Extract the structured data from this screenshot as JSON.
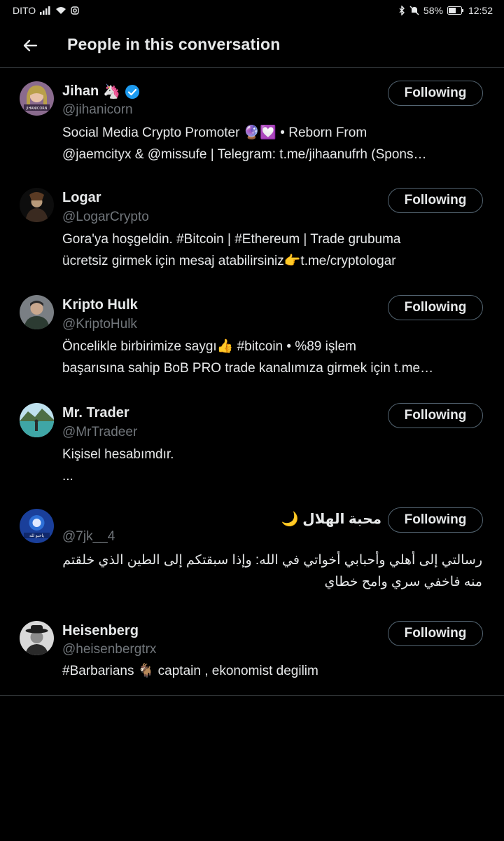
{
  "status_bar": {
    "carrier": "DITO",
    "battery": "58%",
    "time": "12:52"
  },
  "header": {
    "title": "People in this conversation"
  },
  "people": [
    {
      "name": "Jihan",
      "name_emoji": "🦄",
      "verified": true,
      "handle": "@jihanicorn",
      "bio": "Social Media Crypto Promoter 🔮💟 • Reborn From\n@jaemcityx & @missufe | Telegram: t.me/jihaanufrh (Spons…",
      "button": "Following"
    },
    {
      "name": "Logar",
      "handle": "@LogarCrypto",
      "bio": "Gora'ya hoşgeldin. #Bitcoin | #Ethereum | Trade grubuma\nücretsiz girmek için mesaj atabilirsiniz👉t.me/cryptologar",
      "button": "Following"
    },
    {
      "name": "Kripto Hulk",
      "handle": "@KriptoHulk",
      "bio": "Öncelikle birbirimize saygı👍 #bitcoin • %89 işlem\nbaşarısına sahip BoB PRO trade kanalımıza girmek için t.me…",
      "button": "Following"
    },
    {
      "name": "Mr. Trader",
      "handle": "@MrTradeer",
      "bio": "Kişisel hesabımdır.\n...",
      "button": "Following"
    },
    {
      "name": "محبة الهلال 🌙",
      "handle": "@7jk__4",
      "bio": "رسالتي إلى أهلي وأحبابي أخواتي في الله: وإذا سبقتكم إلى الطين الذي خلقتم\nمنه فاخفي سري وامح خطاي",
      "button": "Following"
    },
    {
      "name": "Heisenberg",
      "handle": "@heisenbergtrx",
      "bio": "#Barbarians 🐐 captain , ekonomist degilim",
      "button": "Following"
    }
  ],
  "colors": {
    "background": "#000000",
    "text": "#e7e9ea",
    "secondary": "#71767b",
    "border": "#2f3336",
    "verified": "#1d9bf0"
  }
}
